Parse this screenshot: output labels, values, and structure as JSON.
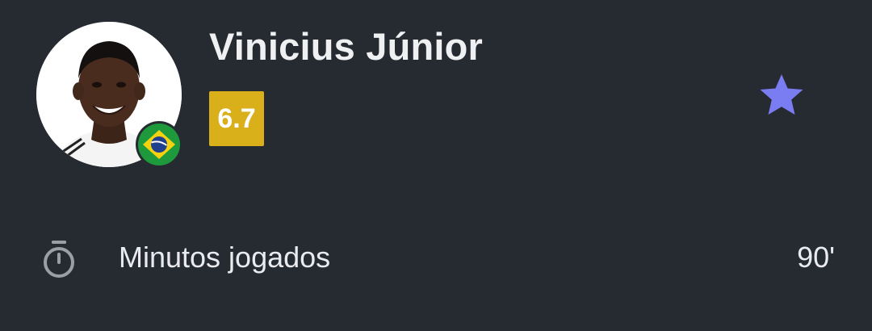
{
  "player": {
    "name": "Vinicius Júnior",
    "rating": "6.7",
    "nationality_flag_icon": "brazil-flag-icon",
    "avatar_icon": "player-photo"
  },
  "actions": {
    "favorite_icon": "star-icon"
  },
  "stats": [
    {
      "icon": "stopwatch-icon",
      "label": "Minutos jogados",
      "value": "90'"
    }
  ],
  "colors": {
    "background": "#262a31",
    "rating_badge": "#d9b01a",
    "star": "#7a7cf2",
    "muted_icon": "#9a9ea6"
  }
}
